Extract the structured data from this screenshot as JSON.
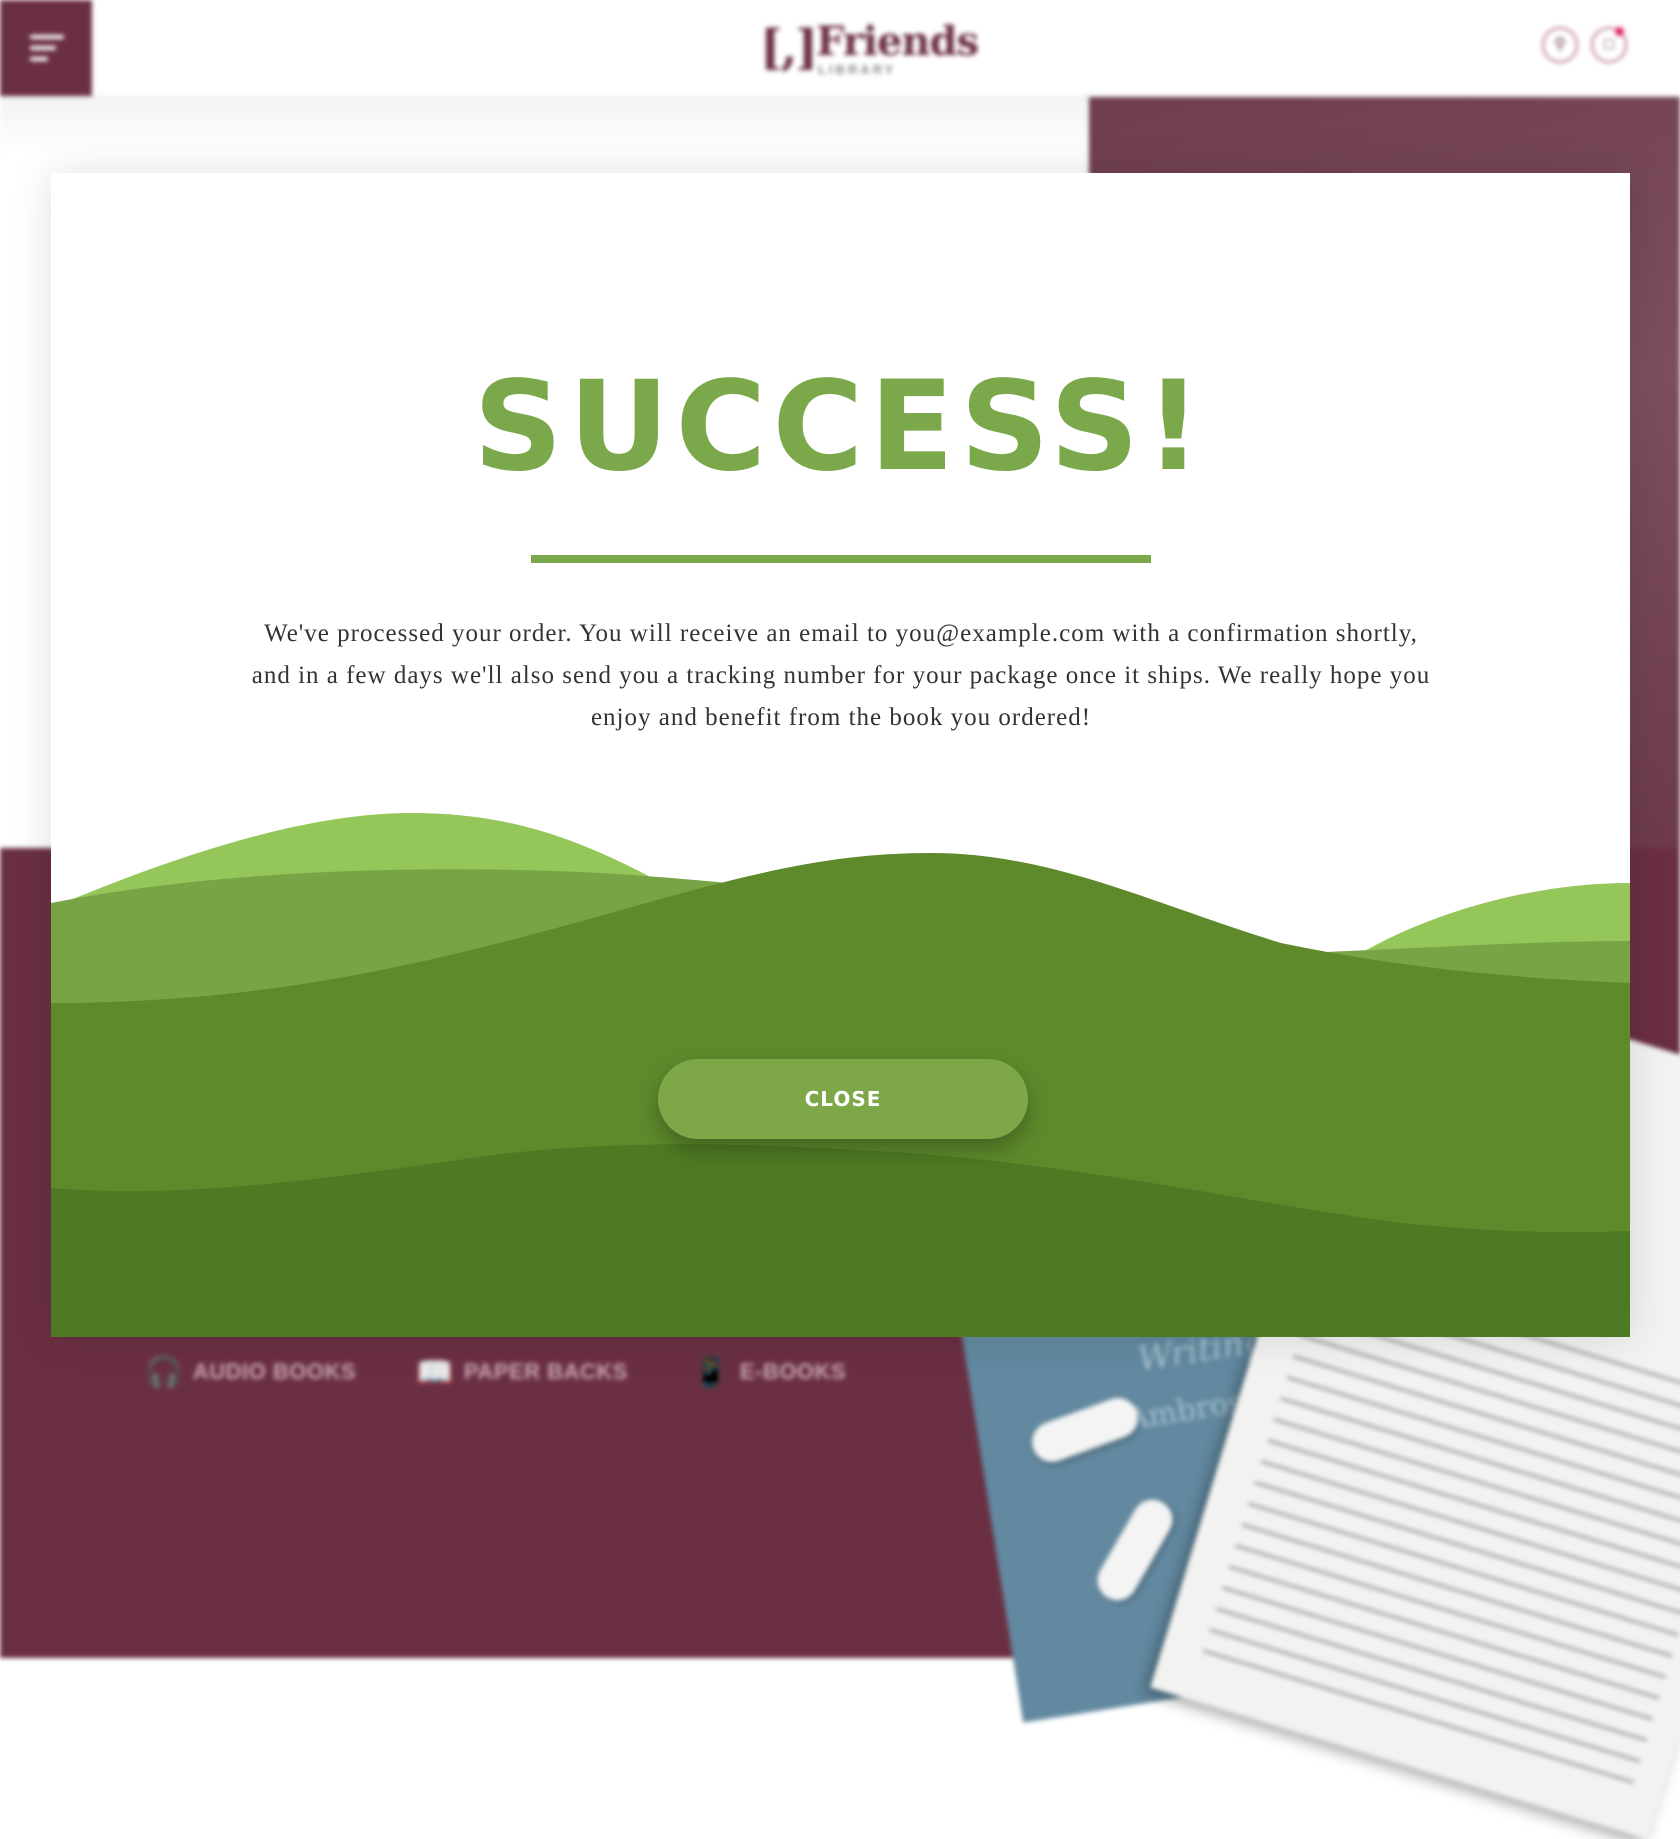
{
  "header": {
    "logo_mark": "[,]",
    "logo_word": "Friends",
    "logo_sub": "LIBRARY"
  },
  "formats": [
    {
      "label": "AUDIO BOOKS",
      "icon": "headphones-icon"
    },
    {
      "label": "PAPER BACKS",
      "icon": "open-book-icon"
    },
    {
      "label": "E-BOOKS",
      "icon": "tablet-icon"
    }
  ],
  "background_book": {
    "title": "Writings",
    "subtitle": "Ambrose"
  },
  "modal": {
    "title": "SUCCESS!",
    "message": "We've processed your order. You will receive an email to you@example.com with a confirmation shortly, and in a few days we'll also send you a tracking number for your package once it ships. We really hope you enjoy and benefit from the book you ordered!",
    "close_label": "CLOSE"
  },
  "colors": {
    "brand_maroon": "#6b2f43",
    "success_green": "#7ba84b",
    "hill_light": "#95c659",
    "hill_mid": "#78a446",
    "hill_dark": "#5e8a2c",
    "hill_darkest": "#4f7a24"
  }
}
